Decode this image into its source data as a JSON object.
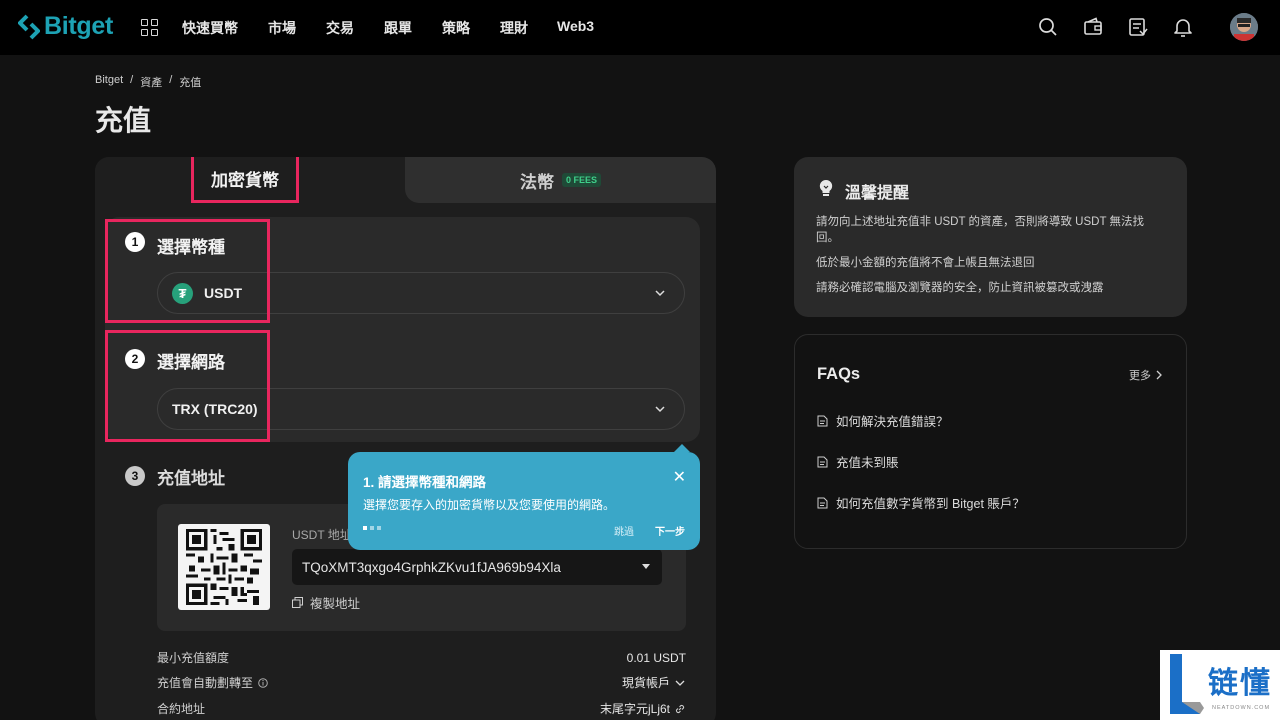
{
  "nav": {
    "brand": "Bitget",
    "links": [
      "快速買幣",
      "市場",
      "交易",
      "跟單",
      "策略",
      "理財",
      "Web3"
    ],
    "icons": [
      "search-icon",
      "wallet-icon",
      "orders-icon",
      "bell-icon"
    ],
    "brand_color": "#1da2b4"
  },
  "breadcrumb": [
    "Bitget",
    "資產",
    "充值"
  ],
  "page_title": "充值",
  "tabs": {
    "crypto": "加密貨幣",
    "fiat": "法幣",
    "fiat_badge": "0 FEES"
  },
  "steps": {
    "step1": {
      "num": "1",
      "title": "選擇幣種",
      "value": "USDT",
      "coin_symbol": "₮"
    },
    "step2": {
      "num": "2",
      "title": "選擇網路",
      "value": "TRX (TRC20)"
    },
    "step3": {
      "num": "3",
      "title": "充值地址"
    }
  },
  "address": {
    "label": "USDT 地址",
    "value": "TQoXMT3qxgo4GrphkZKvu1fJA969b94Xla",
    "copy_label": "複製地址"
  },
  "info": [
    {
      "label": "最小充值額度",
      "value": "0.01 USDT"
    },
    {
      "label": "充值會自動劃轉至",
      "value": "現貨帳戶"
    },
    {
      "label": "合約地址",
      "value": "末尾字元jLj6t"
    }
  ],
  "tooltip": {
    "title": "1. 請選擇幣種和網路",
    "desc": "選擇您要存入的加密貨幣以及您要使用的網路。",
    "skip": "跳過",
    "next": "下一步",
    "close": "✕"
  },
  "tips": {
    "title": "溫馨提醒",
    "items": [
      "請勿向上述地址充值非 USDT 的資產，否則將導致 USDT 無法找回。",
      "低於最小金額的充值將不會上帳且無法退回",
      "請務必確認電腦及瀏覽器的安全，防止資訊被篡改或洩露"
    ]
  },
  "faq": {
    "title": "FAQs",
    "more": "更多",
    "items": [
      "如何解決充值錯誤？",
      "充值未到賬",
      "如何充值數字貨幣到 Bitget 賬戶？"
    ]
  },
  "watermark": {
    "text": "链懂",
    "sub": "NEATDOWN.COM"
  },
  "colors": {
    "highlight": "#e8265e",
    "tooltip": "#3aa7c8",
    "usdt": "#27a17b"
  }
}
